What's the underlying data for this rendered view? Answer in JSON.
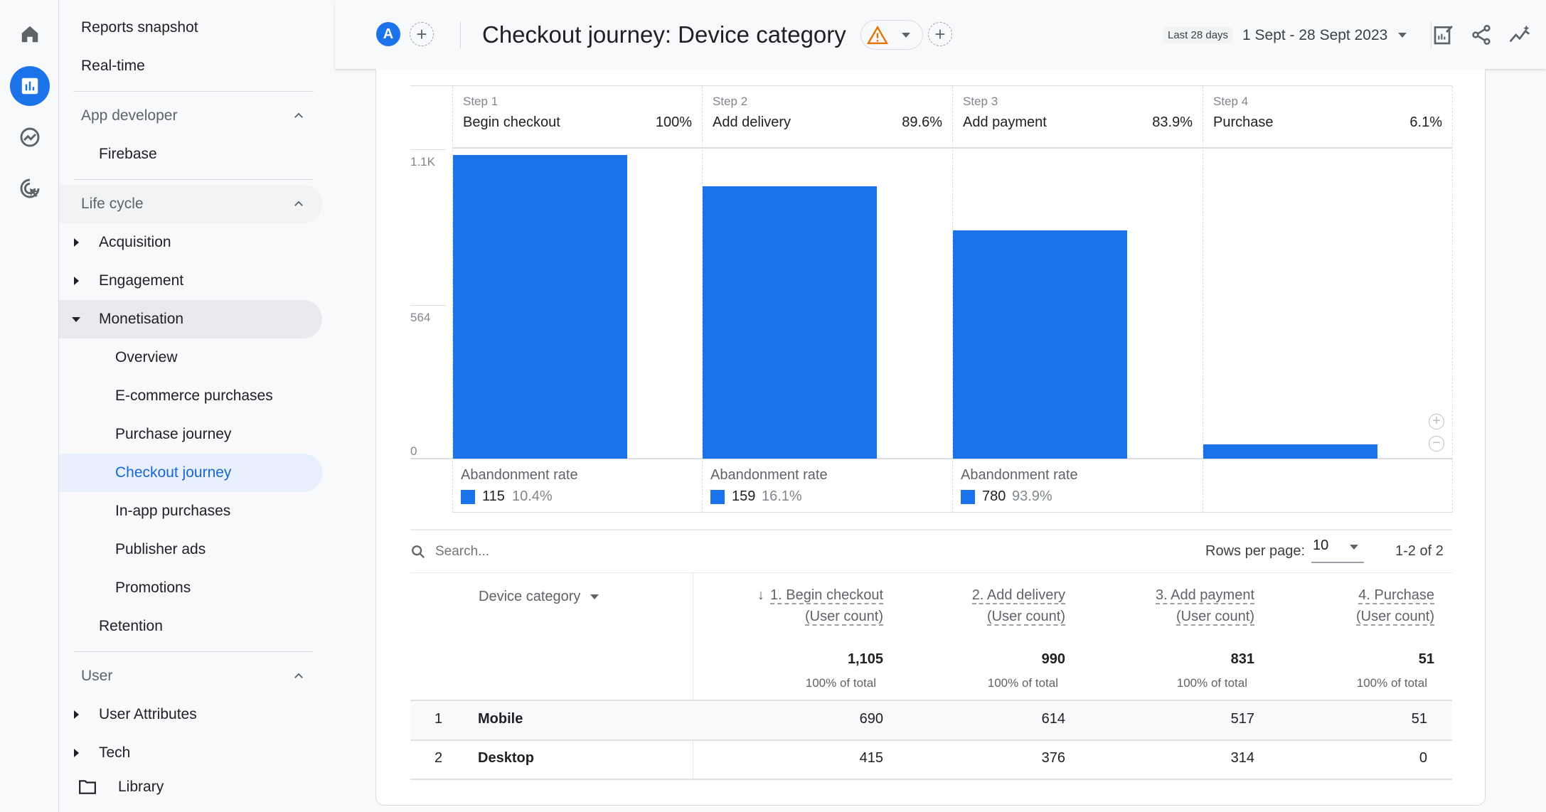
{
  "rail": {
    "icons": [
      "home-icon",
      "reports-icon",
      "explore-icon",
      "advertising-icon"
    ],
    "accent": "#1a73e8"
  },
  "sidebar": {
    "items": [
      {
        "label": "Reports snapshot",
        "level": 0,
        "type": "item"
      },
      {
        "label": "Real-time",
        "level": 0,
        "type": "item"
      },
      {
        "type": "divider"
      },
      {
        "label": "App developer",
        "level": 0,
        "type": "header",
        "expanded": true
      },
      {
        "label": "Firebase",
        "level": 1,
        "type": "item"
      },
      {
        "type": "divider"
      },
      {
        "label": "Life cycle",
        "level": 0,
        "type": "header",
        "expanded": true,
        "bg": "gray"
      },
      {
        "label": "Acquisition",
        "level": 1,
        "type": "item",
        "caret": "right"
      },
      {
        "label": "Engagement",
        "level": 1,
        "type": "item",
        "caret": "right"
      },
      {
        "label": "Monetisation",
        "level": 1,
        "type": "item",
        "caret": "down",
        "bg": "darkgray"
      },
      {
        "label": "Overview",
        "level": 2,
        "type": "item"
      },
      {
        "label": "E-commerce purchases",
        "level": 2,
        "type": "item"
      },
      {
        "label": "Purchase journey",
        "level": 2,
        "type": "item"
      },
      {
        "label": "Checkout journey",
        "level": 2,
        "type": "item",
        "active": true
      },
      {
        "label": "In-app purchases",
        "level": 2,
        "type": "item"
      },
      {
        "label": "Publisher ads",
        "level": 2,
        "type": "item"
      },
      {
        "label": "Promotions",
        "level": 2,
        "type": "item"
      },
      {
        "label": "Retention",
        "level": 1,
        "type": "item"
      },
      {
        "type": "divider"
      },
      {
        "label": "User",
        "level": 0,
        "type": "header",
        "expanded": true
      },
      {
        "label": "User Attributes",
        "level": 1,
        "type": "item",
        "caret": "right"
      },
      {
        "label": "Tech",
        "level": 1,
        "type": "item",
        "caret": "right"
      }
    ],
    "library": "Library"
  },
  "header": {
    "avatar": "A",
    "title": "Checkout journey: Device category",
    "date_chip": "Last 28 days",
    "date_range": "1 Sept - 28 Sept 2023",
    "warning_color": "#e37400"
  },
  "chart_data": {
    "type": "bar",
    "yticks": [
      "1.1K",
      "564",
      "0"
    ],
    "ylim": [
      0,
      1128
    ],
    "steps": [
      {
        "step": "Step 1",
        "name": "Begin checkout",
        "pct": "100%",
        "value": 1105,
        "ab_count": "115",
        "ab_rate": "10.4%"
      },
      {
        "step": "Step 2",
        "name": "Add delivery",
        "pct": "89.6%",
        "value": 990,
        "ab_count": "159",
        "ab_rate": "16.1%"
      },
      {
        "step": "Step 3",
        "name": "Add payment",
        "pct": "83.9%",
        "value": 831,
        "ab_count": "780",
        "ab_rate": "93.9%"
      },
      {
        "step": "Step 4",
        "name": "Purchase",
        "pct": "6.1%",
        "value": 51
      }
    ],
    "abandonment_label": "Abandonment rate",
    "bar_color": "#1a73e8"
  },
  "table": {
    "search_placeholder": "Search...",
    "rows_per_page_label": "Rows per page:",
    "rows_per_page": "10",
    "pagination": "1-2 of 2",
    "dimension": "Device category",
    "columns": [
      {
        "l1": "1. Begin checkout",
        "l2": "(User count)",
        "total": "1,105",
        "pct": "100% of total"
      },
      {
        "l1": "2. Add delivery",
        "l2": "(User count)",
        "total": "990",
        "pct": "100% of total"
      },
      {
        "l1": "3. Add payment",
        "l2": "(User count)",
        "total": "831",
        "pct": "100% of total"
      },
      {
        "l1": "4. Purchase",
        "l2": "(User count)",
        "total": "51",
        "pct": "100% of total"
      }
    ],
    "rows": [
      {
        "idx": "1",
        "name": "Mobile",
        "vals": [
          "690",
          "614",
          "517",
          "51"
        ]
      },
      {
        "idx": "2",
        "name": "Desktop",
        "vals": [
          "415",
          "376",
          "314",
          "0"
        ]
      }
    ]
  }
}
